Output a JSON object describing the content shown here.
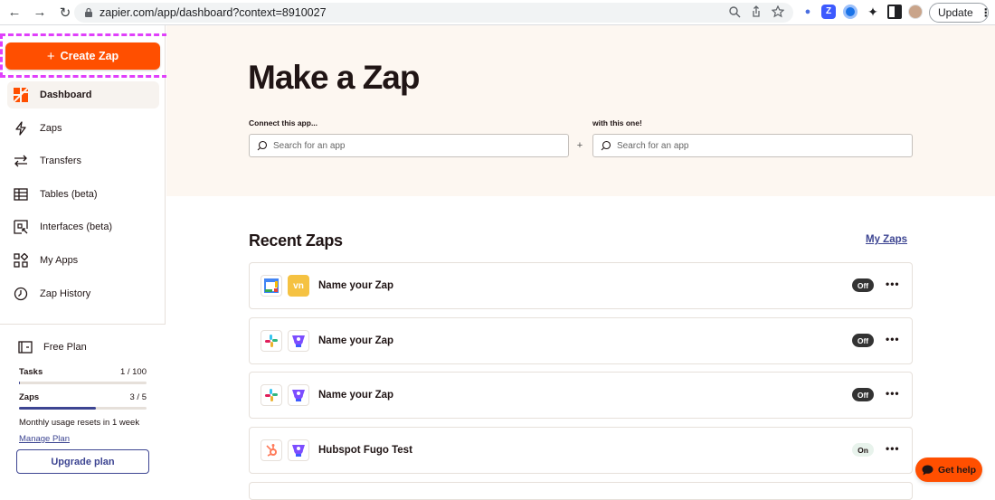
{
  "browser": {
    "url": "zapier.com/app/dashboard?context=8910027",
    "update_label": "Update"
  },
  "sidebar": {
    "create_label": "Create Zap",
    "items": [
      {
        "label": "Dashboard",
        "icon": "dashboard-icon",
        "active": true
      },
      {
        "label": "Zaps",
        "icon": "lightning-icon"
      },
      {
        "label": "Transfers",
        "icon": "transfer-icon"
      },
      {
        "label": "Tables (beta)",
        "icon": "table-icon"
      },
      {
        "label": "Interfaces (beta)",
        "icon": "interface-icon"
      },
      {
        "label": "My Apps",
        "icon": "apps-icon"
      },
      {
        "label": "Zap History",
        "icon": "clock-icon"
      }
    ],
    "plan": {
      "name": "Free Plan",
      "tasks_label": "Tasks",
      "tasks_value": "1 / 100",
      "tasks_fraction": 0.01,
      "zaps_label": "Zaps",
      "zaps_value": "3 / 5",
      "zaps_fraction": 0.6,
      "resets": "Monthly usage resets in 1 week",
      "manage": "Manage Plan",
      "upgrade": "Upgrade plan"
    }
  },
  "hero": {
    "title": "Make a Zap",
    "connect_label": "Connect this app...",
    "with_label": "with this one!",
    "search_placeholder": "Search for an app",
    "plus": "+"
  },
  "recent": {
    "title": "Recent Zaps",
    "my_zaps": "My Zaps",
    "zaps": [
      {
        "name": "Name your Zap",
        "status": "Off",
        "apps": [
          "google-calendar-icon",
          "vn-app-icon"
        ]
      },
      {
        "name": "Name your Zap",
        "status": "Off",
        "apps": [
          "slack-icon",
          "fugo-icon"
        ]
      },
      {
        "name": "Name your Zap",
        "status": "Off",
        "apps": [
          "slack-icon",
          "fugo-icon"
        ]
      },
      {
        "name": "Hubspot Fugo Test",
        "status": "On",
        "apps": [
          "hubspot-icon",
          "fugo-icon"
        ]
      }
    ],
    "more": "•••"
  },
  "help": {
    "label": "Get help"
  },
  "colors": {
    "brand": "#ff4f00",
    "hero_bg": "#fdf7f1",
    "link": "#3d4592",
    "highlight": "#e040fb"
  }
}
